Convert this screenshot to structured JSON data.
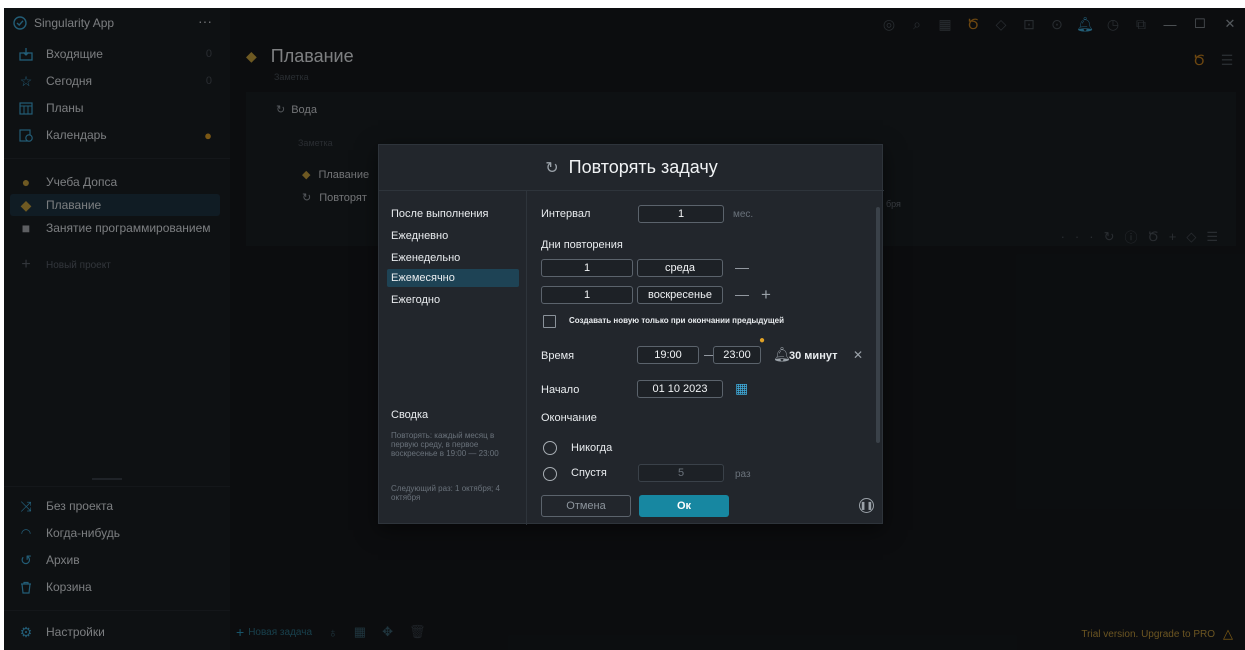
{
  "app": {
    "title": "Singularity App",
    "menu_icon": "more-icon"
  },
  "sidebar": {
    "top": [
      {
        "label": "Входящие",
        "count": "0",
        "icon": "inbox-icon"
      },
      {
        "label": "Сегодня",
        "count": "0",
        "icon": "star-icon"
      },
      {
        "label": "Планы",
        "count": "",
        "icon": "plans-icon"
      },
      {
        "label": "Календарь",
        "count": "",
        "icon": "calendar-icon"
      }
    ],
    "projects": [
      {
        "label": "Учеба Допса",
        "icon": "project-icon"
      },
      {
        "label": "Плавание",
        "icon": "project-icon"
      },
      {
        "label": "Занятие программированием",
        "icon": "project-icon"
      }
    ],
    "new_project": "Новый проект",
    "bottom": [
      {
        "label": "Без проекта",
        "icon": "shuffle-icon"
      },
      {
        "label": "Когда-нибудь",
        "icon": "rainbow-icon"
      },
      {
        "label": "Архив",
        "icon": "archive-icon"
      },
      {
        "label": "Корзина",
        "icon": "trash-icon"
      }
    ],
    "settings": "Настройки"
  },
  "main": {
    "title": "Плавание",
    "subtitle": "Заметка",
    "task_group": "Вода",
    "task_note": "Заметка",
    "task_project": "Плавание",
    "task_repeat": "Повторят",
    "behind_text": "бря"
  },
  "dialog": {
    "title": "Повторять задачу",
    "options": [
      "После выполнения",
      "Ежедневно",
      "Еженедельно",
      "Ежемесячно",
      "Ежегодно"
    ],
    "selected_option": "Ежемесячно",
    "interval_label": "Интервал",
    "interval_value": "1",
    "interval_unit": "мес.",
    "days_label": "Дни повторения",
    "days": [
      {
        "num": "1",
        "day": "среда"
      },
      {
        "num": "1",
        "day": "воскресенье"
      }
    ],
    "create_only_label": "Создавать новую только при окончании предыдущей",
    "time_label": "Время",
    "time_start": "19:00",
    "time_end": "23:00",
    "reminder": "30 минут",
    "start_label": "Начало",
    "start_date": "01 10 2023",
    "end_label": "Окончание",
    "end_never": "Никогда",
    "end_after": "Спустя",
    "end_after_value": "5",
    "end_after_unit": "раз",
    "summary_title": "Сводка",
    "summary_text": "Повторять: каждый месяц в первую среду, в первое воскресенье в 19:00 — 23:00",
    "next_text": "Следующий раз: 1 октября; 4 октября",
    "cancel": "Отмена",
    "ok": "Ок"
  },
  "bottom": {
    "new_task": "Новая задача",
    "trial": "Trial version. Upgrade to PRO"
  }
}
